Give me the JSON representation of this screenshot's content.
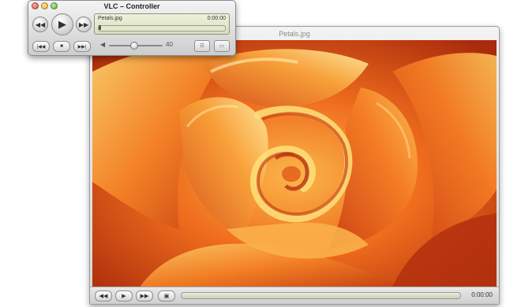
{
  "controller": {
    "title": "VLC – Controller",
    "now_playing_file": "Petals.jpg",
    "elapsed_time": "0:00:00",
    "position_fraction": 0.0,
    "volume_value": "40",
    "volume_fraction": 0.45,
    "buttons": {
      "rewind": "◀◀",
      "play": "▶",
      "fast_forward": "▶▶",
      "previous": "|◀◀",
      "stop": "■",
      "next": "▶▶|",
      "volume_icon": "◀",
      "playlist": "☷",
      "fullscreen": "▭"
    }
  },
  "video_window": {
    "title": "Petals.jpg",
    "time": "0:00:00",
    "position_fraction": 0.0,
    "buttons": {
      "rewind": "◀◀",
      "play": "▶",
      "fast_forward": "▶▶",
      "fullscreen": "▣"
    }
  },
  "colors": {
    "window_chrome": "#d6d6d6",
    "lcd_background": "#e4e8cf",
    "petal_dark": "#b8320f",
    "petal_mid": "#f0701c",
    "petal_light": "#fdc25a"
  }
}
